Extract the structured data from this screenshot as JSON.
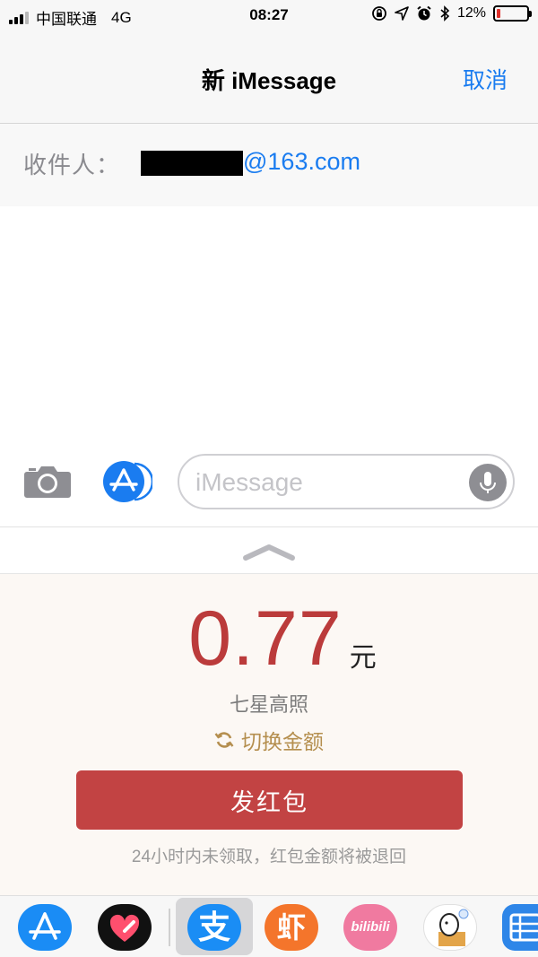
{
  "status_bar": {
    "carrier": "中国联通",
    "network": "4G",
    "time": "08:27",
    "battery_percent": "12%",
    "battery_level": 0.12,
    "icons": [
      "signal-icon",
      "orientation-lock-icon",
      "location-icon",
      "alarm-icon",
      "bluetooth-icon",
      "battery-icon"
    ]
  },
  "nav": {
    "title": "新 iMessage",
    "cancel_label": "取消"
  },
  "recipient": {
    "label": "收件人：",
    "email_domain": "@163.com"
  },
  "composer": {
    "placeholder": "iMessage"
  },
  "red_packet": {
    "amount": "0.77",
    "currency": "元",
    "greeting": "七星高照",
    "switch_label": "切换金额",
    "send_label": "发红包",
    "note": "24小时内未领取，红包金额将被退回"
  },
  "app_drawer": {
    "apps": [
      "app-store-icon",
      "digital-touch-icon",
      "alipay-icon",
      "xiami-icon",
      "bilibili-icon",
      "dog-sticker-icon",
      "film-icon"
    ],
    "selected": "alipay-icon",
    "xiami_glyph": "虾",
    "alipay_glyph": "支",
    "bilibili_text": "bilibili"
  },
  "colors": {
    "accent": "#1a7cf0",
    "red_packet": "#c24343",
    "amount": "#bb3b3b",
    "gold": "#b58f4f"
  }
}
